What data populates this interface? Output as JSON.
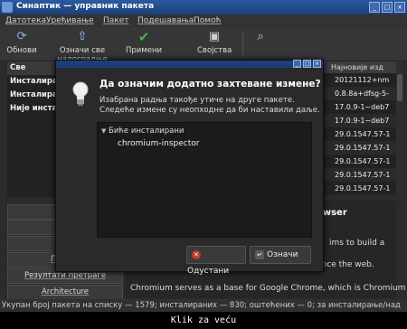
{
  "window": {
    "title": "Синаптик — управник пакета"
  },
  "menu": [
    "Датотека",
    "Уређивање",
    "Пакет",
    "Подешавања",
    "Помоћ"
  ],
  "toolbar": {
    "reload_label": "Обнови",
    "mark_upgrades_label": "Означи све надоградње",
    "apply_label": "Примени",
    "properties_label": "Својства"
  },
  "sidebar": {
    "items": [
      "Све",
      "Инсталиран",
      "Инсталиран",
      "Није инстал"
    ]
  },
  "table": {
    "header": "Најновије изд",
    "rows": [
      "20121112+nm",
      "0.8.8a+dfsg-5-",
      "17.0.9-1~deb7",
      "17.0.9-1~deb7",
      "29.0.1547.57-1",
      "29.0.1547.57-1",
      "29.0.1547.57-1",
      "29.0.1547.57-1",
      "29.0.1547.57-1"
    ]
  },
  "filters": [
    "С",
    "С",
    "П",
    "Произв",
    "Резултати претраге",
    "Architecture"
  ],
  "description": {
    "title": "owser",
    "line1": "ims to build a",
    "line2": "ence the web.",
    "line3": "Chromium serves as a base for Google Chrome, which is Chromium"
  },
  "status_bar": "Укупан број пакета на списку — 1579; инсталираних — 830; оштећених — 0; за инсталирање/над",
  "bottom_caption": "Klik za veću",
  "dialog": {
    "heading": "Да означим додатно захтеване измене?",
    "subtitle_line1": "Изабрана радња такође утиче на друге пакете.",
    "subtitle_line2": "Следеће измене су неопходне да би наставили даље.",
    "group_label": "Биће инсталирани",
    "packages": [
      "chromium-inspector"
    ],
    "cancel_label": "Одустани",
    "mark_label": "Означи"
  },
  "colors": {
    "titlebar": "#1c3f7a",
    "apply_check": "#4caf50",
    "cancel_icon": "#c0392b"
  },
  "icons": [
    "app-icon",
    "reload-icon",
    "mark-upgrades-icon",
    "apply-check-icon",
    "properties-icon",
    "search-icon",
    "lightbulb-icon",
    "cancel-icon",
    "mark-arrow-icon"
  ]
}
